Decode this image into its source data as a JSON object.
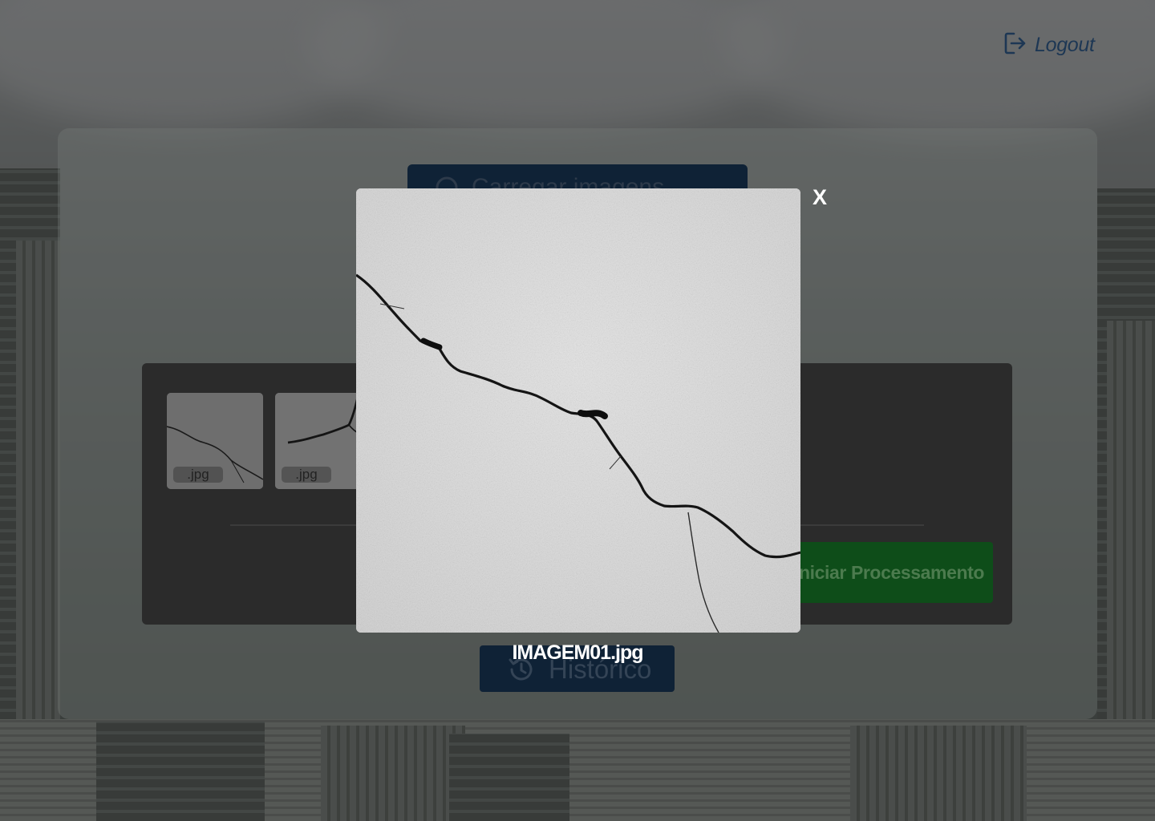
{
  "header": {
    "logout_label": "Logout",
    "logout_icon": "logout-icon"
  },
  "upload": {
    "label": "Carregar imagens",
    "icon": "upload-icon"
  },
  "thumbnails": [
    {
      "ext": ".jpg"
    },
    {
      "ext": ".jpg"
    }
  ],
  "actions": {
    "start_label": "Iniciar Processamento",
    "history_label": "Histórico",
    "history_icon": "history-icon"
  },
  "modal": {
    "close_label": "X",
    "caption": "IMAGEM01.jpg"
  },
  "colors": {
    "navy": "#0f2236",
    "green": "#0e4d19",
    "panel": "#2b2b2b"
  }
}
